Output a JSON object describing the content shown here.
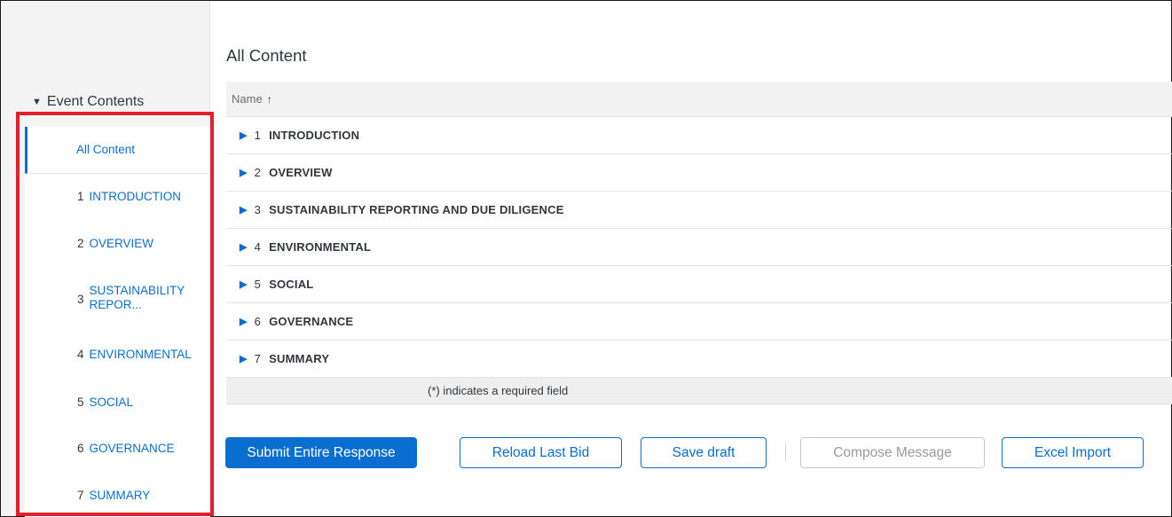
{
  "sidebar": {
    "header": "Event Contents",
    "header_icon": "triangle-down-icon",
    "items": [
      {
        "num": "",
        "label": "All Content",
        "active": true
      },
      {
        "num": "1",
        "label": "INTRODUCTION"
      },
      {
        "num": "2",
        "label": "OVERVIEW"
      },
      {
        "num": "3",
        "label": "SUSTAINABILITY REPOR..."
      },
      {
        "num": "4",
        "label": "ENVIRONMENTAL"
      },
      {
        "num": "5",
        "label": "SOCIAL"
      },
      {
        "num": "6",
        "label": "GOVERNANCE"
      },
      {
        "num": "7",
        "label": "SUMMARY"
      }
    ]
  },
  "main": {
    "title": "All Content",
    "table": {
      "column_header": "Name",
      "sort_icon": "sort-ascending-icon",
      "rows": [
        {
          "num": "1",
          "label": "INTRODUCTION"
        },
        {
          "num": "2",
          "label": "OVERVIEW"
        },
        {
          "num": "3",
          "label": "SUSTAINABILITY REPORTING AND DUE DILIGENCE"
        },
        {
          "num": "4",
          "label": "ENVIRONMENTAL"
        },
        {
          "num": "5",
          "label": "SOCIAL"
        },
        {
          "num": "6",
          "label": "GOVERNANCE"
        },
        {
          "num": "7",
          "label": "SUMMARY"
        }
      ],
      "footer_note": "(*) indicates a required field"
    }
  },
  "actions": {
    "submit": "Submit Entire Response",
    "reload": "Reload Last Bid",
    "save_draft": "Save draft",
    "compose": "Compose Message",
    "excel_import": "Excel Import"
  },
  "colors": {
    "accent": "#0a6ed1",
    "highlight_border": "#e0202a",
    "text": "#32363a"
  }
}
